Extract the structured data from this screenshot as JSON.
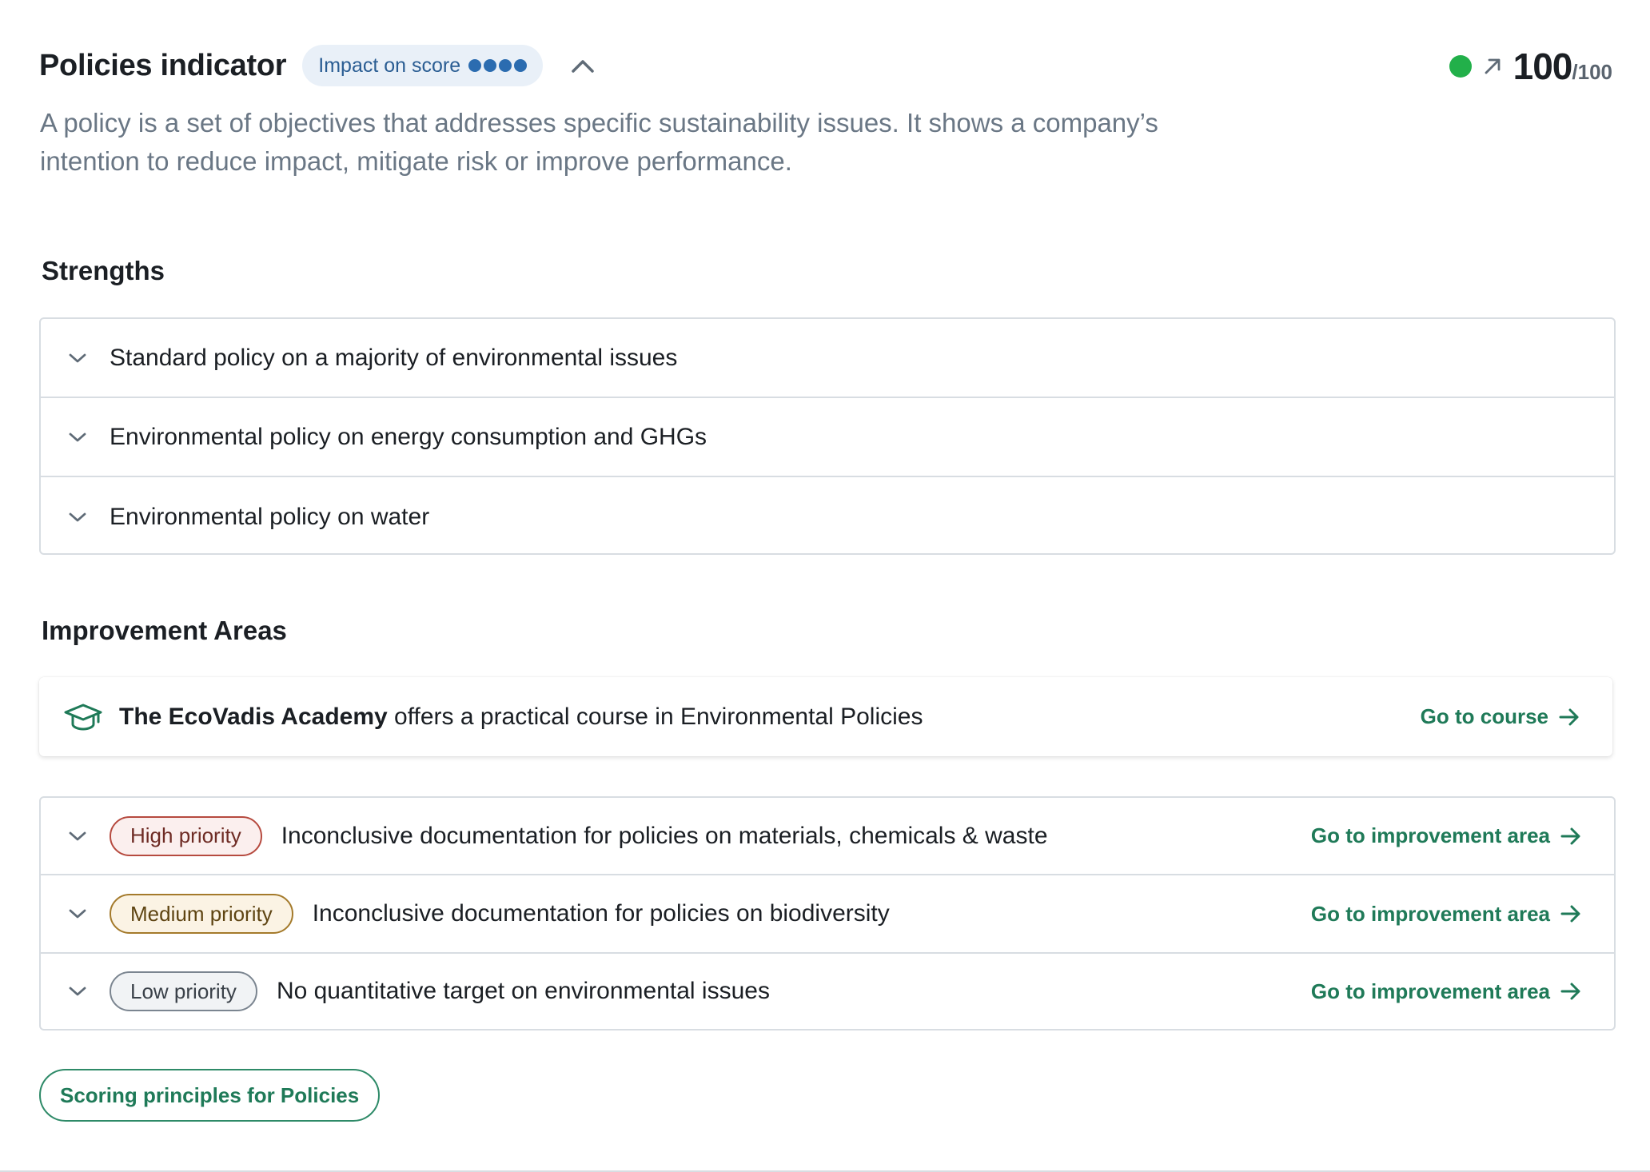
{
  "header": {
    "title": "Policies indicator",
    "impact_label": "Impact on score",
    "impact_level": 4,
    "impact_max": 4,
    "score_status_color": "#22b04a",
    "score_value": "100",
    "score_max": "/100",
    "trend_icon": "arrow-up-right-icon",
    "collapse_icon": "chevron-up-icon"
  },
  "description": "A policy is a set of objectives that addresses specific sustainability issues. It shows a company’s intention to reduce impact, mitigate risk or improve performance.",
  "strengths": {
    "title": "Strengths",
    "items": [
      {
        "label": "Standard policy on a majority of environmental issues"
      },
      {
        "label": "Environmental policy on energy consumption and GHGs"
      },
      {
        "label": "Environmental policy on water"
      }
    ]
  },
  "improvement": {
    "title": "Improvement Areas",
    "academy": {
      "icon": "graduation-cap-icon",
      "brand": "The EcoVadis Academy",
      "text": " offers a practical course in Environmental Policies",
      "link": "Go to course"
    },
    "items": [
      {
        "priority": "High priority",
        "label": "Inconclusive documentation for policies on materials, chemicals & waste",
        "link": "Go to improvement area"
      },
      {
        "priority": "Medium priority",
        "label": "Inconclusive documentation for policies on biodiversity",
        "link": "Go to improvement area"
      },
      {
        "priority": "Low priority",
        "label": "No quantitative target on environmental issues",
        "link": "Go to improvement area"
      }
    ]
  },
  "scoring_button": "Scoring principles for Policies",
  "colors": {
    "accent_green": "#1f7a58",
    "high": "#b64a3f",
    "medium": "#a47a2b",
    "low": "#7b8590",
    "impact_blue": "#2b6cb0"
  }
}
